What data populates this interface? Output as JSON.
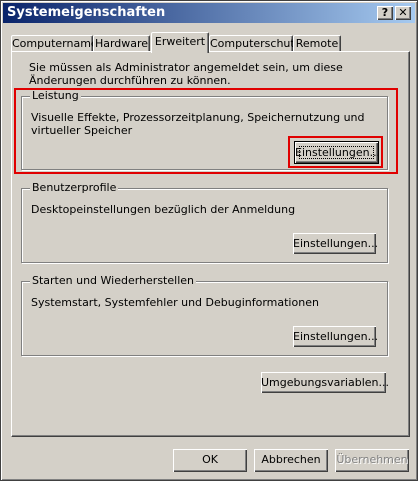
{
  "window": {
    "title": "Systemeigenschaften",
    "help_label": "?",
    "close_label": "✕"
  },
  "tabs": [
    {
      "label": "Computername",
      "active": false
    },
    {
      "label": "Hardware",
      "active": false
    },
    {
      "label": "Erweitert",
      "active": true
    },
    {
      "label": "Computerschutz",
      "active": false
    },
    {
      "label": "Remote",
      "active": false
    }
  ],
  "notice": "Sie müssen als Administrator angemeldet sein, um diese Änderungen durchführen zu können.",
  "groups": {
    "performance": {
      "title": "Leistung",
      "description": "Visuelle Effekte, Prozessorzeitplanung, Speichernutzung und virtueller Speicher",
      "button": "Einstellungen..."
    },
    "profiles": {
      "title": "Benutzerprofile",
      "description": "Desktopeinstellungen bezüglich der Anmeldung",
      "button": "Einstellungen..."
    },
    "startup": {
      "title": "Starten und Wiederherstellen",
      "description": "Systemstart, Systemfehler und Debuginformationen",
      "button": "Einstellungen..."
    }
  },
  "env_button": "Umgebungsvariablen...",
  "footer": {
    "ok": "OK",
    "cancel": "Abbrechen",
    "apply": "Übernehmen"
  },
  "colors": {
    "face": "#d4d0c8",
    "title_start": "#0a246a",
    "title_end": "#a6caf0",
    "highlight": "#e00000"
  }
}
